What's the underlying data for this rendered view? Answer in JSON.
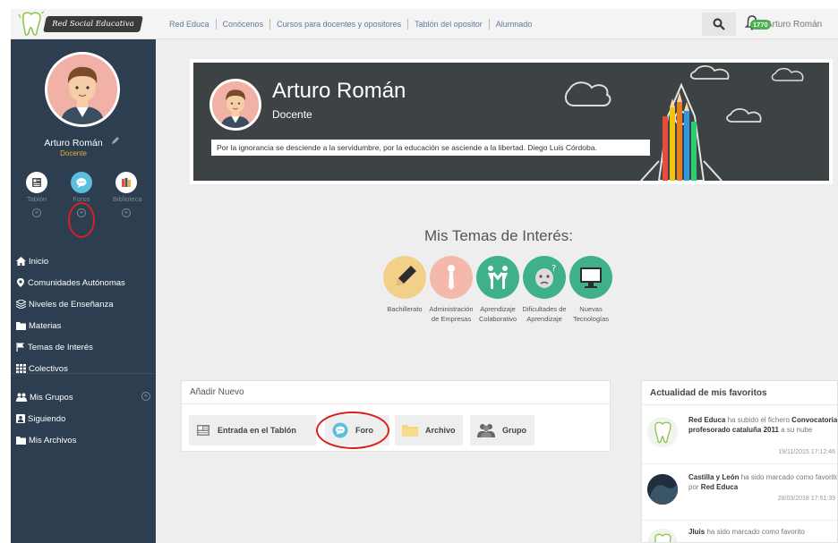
{
  "header": {
    "logo_text": "Red Social Educativa",
    "nav": [
      "Red Educa",
      "Conócenos",
      "Cursos para docentes y opositores",
      "Tablón del opositor",
      "Alumnado"
    ],
    "notification_count": "1770",
    "user_name": "Arturo Román"
  },
  "sidebar": {
    "user_name": "Arturo Román",
    "role": "Docente",
    "quick": [
      "Tablón",
      "Foros",
      "Biblioteca"
    ],
    "menu": [
      "Inicio",
      "Comunidades Autónomas",
      "Niveles de Enseñanza",
      "Materias",
      "Temas de Interés",
      "Colectivos"
    ],
    "menu2": [
      "Mis Grupos",
      "Siguiendo",
      "Mis Archivos"
    ]
  },
  "profile": {
    "name": "Arturo Román",
    "role": "Docente",
    "quote": "Por la ignorancia se desciende a la servidumbre, por la educación se asciende a la libertad. Diego Luis Córdoba."
  },
  "interests": {
    "title": "Mis Temas de Interés:",
    "topics": [
      {
        "label": "Bachillerato",
        "color": "#f2d08a",
        "icon": "pencil-icon"
      },
      {
        "label": "Administración de Empresas",
        "color": "#f4b8ad",
        "icon": "tie-icon"
      },
      {
        "label": "Aprendizaje Colaborativo",
        "color": "#3fb08a",
        "icon": "people-icon"
      },
      {
        "label": "Dificultades de Aprendizaje",
        "color": "#3fb08a",
        "icon": "face-question-icon"
      },
      {
        "label": "Nuevas Tecnologías",
        "color": "#3fb08a",
        "icon": "monitor-icon"
      }
    ]
  },
  "add_new": {
    "title": "Añadir Nuevo",
    "buttons": [
      "Entrada en el Tablón",
      "Foro",
      "Archivo",
      "Grupo"
    ]
  },
  "favorites": {
    "title": "Actualidad de mis favoritos",
    "items": [
      {
        "actor": "Red Educa",
        "pre": " ha subido el fichero ",
        "object": "Convocatoria profesorado cataluña 2011",
        "post": " a su nube",
        "date": "19/11/2015 17:12:46"
      },
      {
        "actor": "Castilla y León",
        "pre": " ha sido marcado como favorito por ",
        "object": "Red Educa",
        "post": "",
        "date": "28/03/2018 17:51:39"
      },
      {
        "actor": "Jluis",
        "pre": " ha sido marcado como favorito",
        "object": "",
        "post": "",
        "date": ""
      }
    ]
  },
  "colors": {
    "sidebar": "#2c3e50",
    "accent_orange": "#f0b030",
    "highlight_red": "#d92020",
    "badge_green": "#4caf50"
  }
}
